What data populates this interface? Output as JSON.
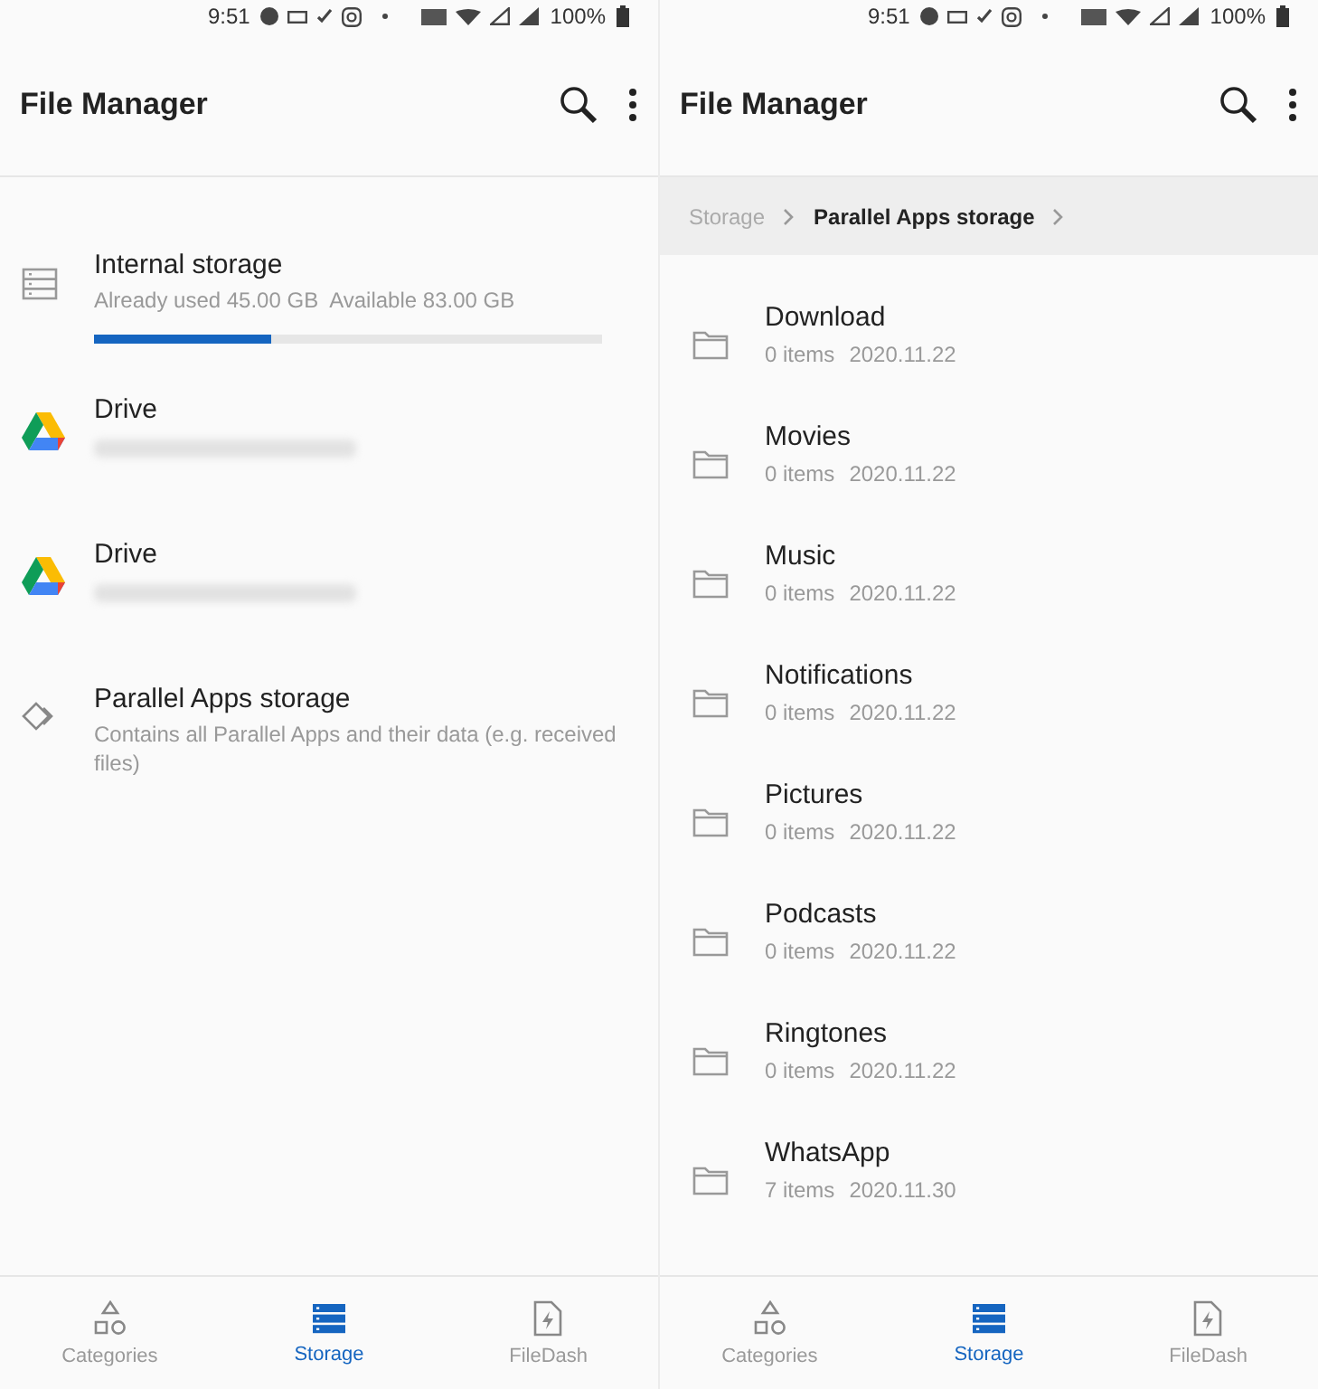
{
  "screens": [
    {
      "status_bar": {
        "time": "9:51",
        "battery": "100%"
      },
      "app_bar": {
        "title": "File Manager"
      },
      "storage_list": [
        {
          "kind": "internal",
          "name": "Internal storage",
          "used": "Already used 45.00 GB",
          "available": "Available 83.00 GB",
          "level": 0.35
        },
        {
          "kind": "drive",
          "name": "Drive"
        },
        {
          "kind": "drive",
          "name": "Drive"
        },
        {
          "kind": "parallel",
          "name": "Parallel Apps storage",
          "description": "Contains all Parallel Apps and their data (e.g. received files)"
        }
      ],
      "bottom_nav": [
        {
          "label": "Categories",
          "kind": "categories",
          "selected": false
        },
        {
          "label": "Storage",
          "kind": "storage",
          "selected": true
        },
        {
          "label": "FileDash",
          "kind": "filedash",
          "selected": false
        }
      ]
    },
    {
      "status_bar": {
        "time": "9:51",
        "battery": "100%"
      },
      "app_bar": {
        "title": "File Manager"
      },
      "breadcrumb": [
        {
          "label": "Storage",
          "selected": false
        },
        {
          "label": "Parallel Apps storage",
          "selected": true
        }
      ],
      "folders": [
        {
          "name": "Download",
          "count": "0 items",
          "date": "2020.11.22"
        },
        {
          "name": "Movies",
          "count": "0 items",
          "date": "2020.11.22"
        },
        {
          "name": "Music",
          "count": "0 items",
          "date": "2020.11.22"
        },
        {
          "name": "Notifications",
          "count": "0 items",
          "date": "2020.11.22"
        },
        {
          "name": "Pictures",
          "count": "0 items",
          "date": "2020.11.22"
        },
        {
          "name": "Podcasts",
          "count": "0 items",
          "date": "2020.11.22"
        },
        {
          "name": "Ringtones",
          "count": "0 items",
          "date": "2020.11.22"
        },
        {
          "name": "WhatsApp",
          "count": "7 items",
          "date": "2020.11.30"
        }
      ],
      "bottom_nav": [
        {
          "label": "Categories",
          "kind": "categories",
          "selected": false
        },
        {
          "label": "Storage",
          "kind": "storage",
          "selected": true
        },
        {
          "label": "FileDash",
          "kind": "filedash",
          "selected": false
        }
      ]
    }
  ]
}
